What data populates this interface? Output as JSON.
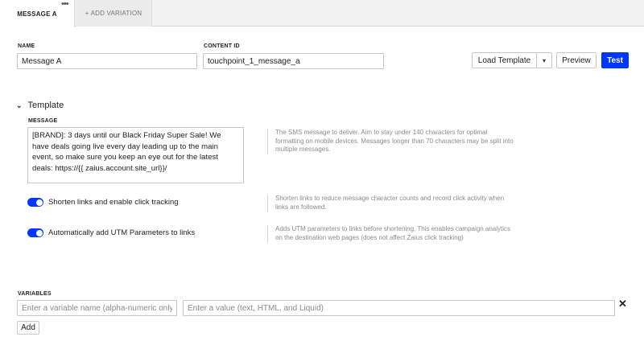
{
  "tabs": {
    "active_label": "MESSAGE A",
    "add_label": "+ ADD VARIATION",
    "menu_glyph": "•••"
  },
  "form": {
    "name_label": "NAME",
    "name_value": "Message A",
    "content_id_label": "CONTENT ID",
    "content_id_value": "touchpoint_1_message_a"
  },
  "toolbar": {
    "load_template_label": "Load Template",
    "dropdown_caret": "▾",
    "preview_label": "Preview",
    "test_label": "Test"
  },
  "template": {
    "chevron": "⌄",
    "title": "Template",
    "message_label": "MESSAGE",
    "message_value": "[BRAND]: 3 days until our Black Friday Super Sale! We have deals going live every day leading up to the main event, so make sure you keep an eye out for the latest deals: https://{{ zaius.account.site_url}}/",
    "message_help": "The SMS message to deliver. Aim to stay under 140 characters for optimal formatting on mobile devices. Messages longer than 70 characters may be split into multiple messages.",
    "shorten_links": {
      "label": "Shorten links and enable click tracking",
      "enabled": true,
      "help": "Shorten links to reduce message character counts and record click activity when links are followed."
    },
    "utm_params": {
      "label": "Automatically add UTM Parameters to links",
      "enabled": true,
      "help": "Adds UTM parameters to links before shortening. This enables campaign analytics on the destination web pages (does not affect Zaius click tracking)"
    }
  },
  "variables": {
    "label": "VARIABLES",
    "name_placeholder": "Enter a variable name (alpha-numeric only)",
    "value_placeholder": "Enter a value (text, HTML, and Liquid)",
    "remove_glyph": "✕",
    "add_label": "Add"
  },
  "colors": {
    "accent": "#0037ff",
    "help_text": "#8c8c8c"
  }
}
